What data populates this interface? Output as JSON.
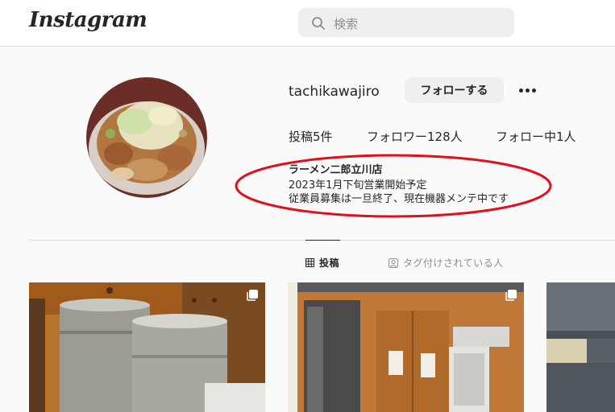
{
  "header": {
    "logo_text": "Instagram",
    "search_placeholder": "検索"
  },
  "profile": {
    "username": "tachikawajiro",
    "follow_label": "フォローする",
    "stats": {
      "posts": "投稿5件",
      "followers": "フォロワー128人",
      "following": "フォロー中1人"
    },
    "bio": {
      "name": "ラーメン二郎立川店",
      "lines": [
        "2023年1月下旬営業開始予定",
        "従業員募集は一旦終了、現在機器メンテ中です"
      ]
    }
  },
  "tabs": [
    {
      "label": "投稿",
      "icon": "grid-icon",
      "active": true
    },
    {
      "label": "タグ付けされている人",
      "icon": "tagged-user-icon",
      "active": false
    }
  ],
  "colors": {
    "annotation": "#e0101a",
    "text": "#262626",
    "muted": "#8e8e8e",
    "border": "#dbdbdb"
  }
}
